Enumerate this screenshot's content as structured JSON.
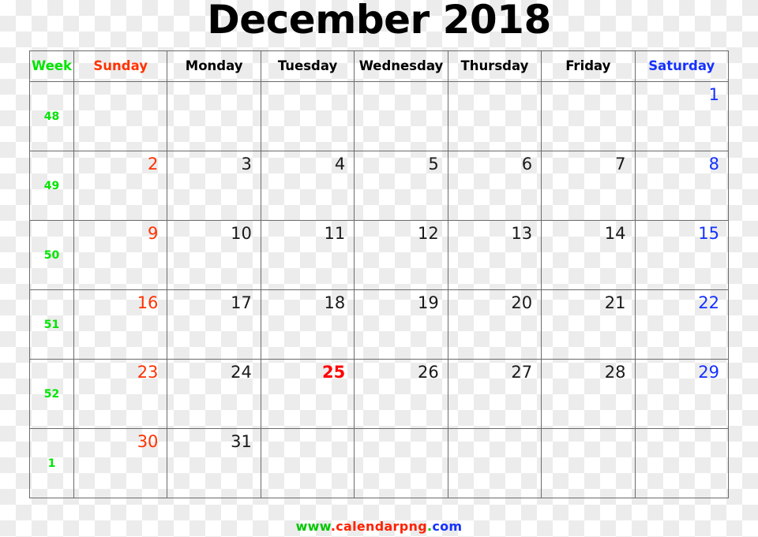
{
  "title": "December 2018",
  "header": {
    "week_label": "Week",
    "days": [
      "Sunday",
      "Monday",
      "Tuesday",
      "Wednesday",
      "Thursday",
      "Friday",
      "Saturday"
    ]
  },
  "colors": {
    "week": "#00e400",
    "sunday": "#ff3200",
    "weekday": "#000000",
    "saturday": "#1531ff",
    "holiday": "#ff0000",
    "grid_line": "#6b6b6b",
    "checker_light": "#ffffff",
    "checker_dark": "#ececec"
  },
  "weeks": [
    {
      "week_number": "48",
      "days": [
        {
          "label": "",
          "type": "empty"
        },
        {
          "label": "",
          "type": "empty"
        },
        {
          "label": "",
          "type": "empty"
        },
        {
          "label": "",
          "type": "empty"
        },
        {
          "label": "",
          "type": "empty"
        },
        {
          "label": "",
          "type": "empty"
        },
        {
          "label": "1",
          "type": "sat"
        }
      ]
    },
    {
      "week_number": "49",
      "days": [
        {
          "label": "2",
          "type": "sun"
        },
        {
          "label": "3",
          "type": "wd"
        },
        {
          "label": "4",
          "type": "wd"
        },
        {
          "label": "5",
          "type": "wd"
        },
        {
          "label": "6",
          "type": "wd"
        },
        {
          "label": "7",
          "type": "wd"
        },
        {
          "label": "8",
          "type": "sat"
        }
      ]
    },
    {
      "week_number": "50",
      "days": [
        {
          "label": "9",
          "type": "sun"
        },
        {
          "label": "10",
          "type": "wd"
        },
        {
          "label": "11",
          "type": "wd"
        },
        {
          "label": "12",
          "type": "wd"
        },
        {
          "label": "13",
          "type": "wd"
        },
        {
          "label": "14",
          "type": "wd"
        },
        {
          "label": "15",
          "type": "sat"
        }
      ]
    },
    {
      "week_number": "51",
      "days": [
        {
          "label": "16",
          "type": "sun"
        },
        {
          "label": "17",
          "type": "wd"
        },
        {
          "label": "18",
          "type": "wd"
        },
        {
          "label": "19",
          "type": "wd"
        },
        {
          "label": "20",
          "type": "wd"
        },
        {
          "label": "21",
          "type": "wd"
        },
        {
          "label": "22",
          "type": "sat"
        }
      ]
    },
    {
      "week_number": "52",
      "days": [
        {
          "label": "23",
          "type": "sun"
        },
        {
          "label": "24",
          "type": "wd"
        },
        {
          "label": "25",
          "type": "holiday"
        },
        {
          "label": "26",
          "type": "wd"
        },
        {
          "label": "27",
          "type": "wd"
        },
        {
          "label": "28",
          "type": "wd"
        },
        {
          "label": "29",
          "type": "sat"
        }
      ]
    },
    {
      "week_number": "1",
      "days": [
        {
          "label": "30",
          "type": "sun"
        },
        {
          "label": "31",
          "type": "wd"
        },
        {
          "label": "",
          "type": "empty"
        },
        {
          "label": "",
          "type": "empty"
        },
        {
          "label": "",
          "type": "empty"
        },
        {
          "label": "",
          "type": "empty"
        },
        {
          "label": "",
          "type": "empty"
        }
      ]
    }
  ],
  "footer": {
    "www": "www",
    "dot1": ".",
    "name": "calendarpng",
    "dot2": ".",
    "tld": "com"
  }
}
